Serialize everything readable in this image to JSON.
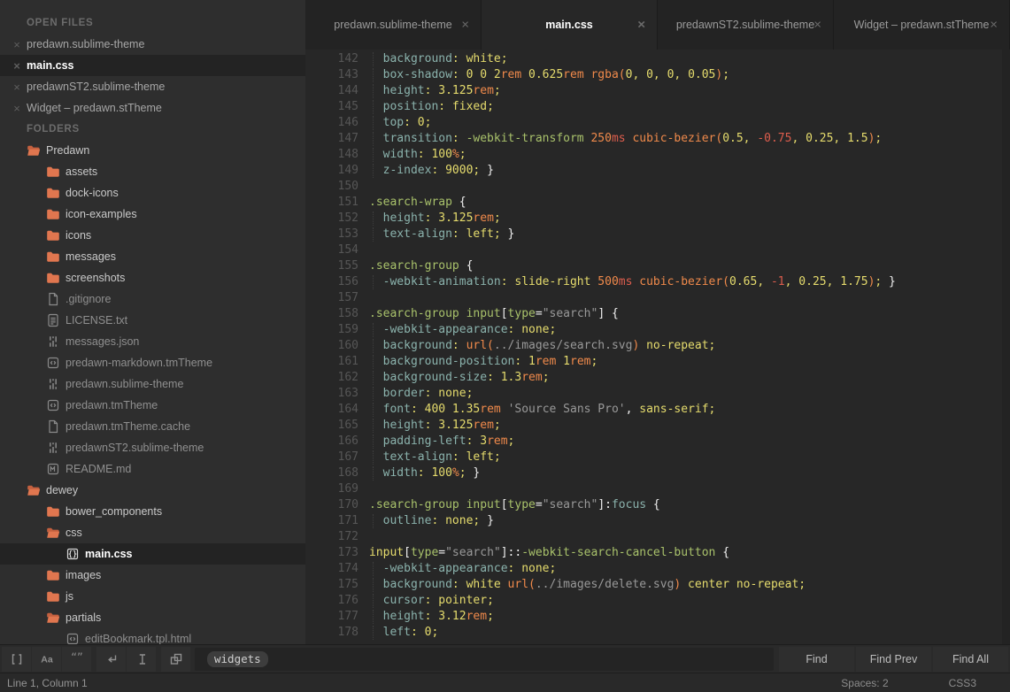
{
  "sidebar": {
    "open_files_heading": "OPEN FILES",
    "folders_heading": "FOLDERS",
    "folder_color": "#e0764f",
    "folder_color_dark": "#c4603f",
    "open_files": [
      {
        "label": "predawn.sublime-theme",
        "selected": false
      },
      {
        "label": "main.css",
        "selected": true
      },
      {
        "label": "predawnST2.sublime-theme",
        "selected": false
      },
      {
        "label": "Widget – predawn.stTheme",
        "selected": false
      }
    ],
    "tree": [
      {
        "label": "Predawn",
        "icon": "folder-open",
        "level": 0
      },
      {
        "label": "assets",
        "icon": "folder",
        "level": 1
      },
      {
        "label": "dock-icons",
        "icon": "folder",
        "level": 1
      },
      {
        "label": "icon-examples",
        "icon": "folder",
        "level": 1
      },
      {
        "label": "icons",
        "icon": "folder",
        "level": 1
      },
      {
        "label": "messages",
        "icon": "folder",
        "level": 1
      },
      {
        "label": "screenshots",
        "icon": "folder",
        "level": 1
      },
      {
        "label": ".gitignore",
        "icon": "file",
        "level": 1,
        "dim": true
      },
      {
        "label": "LICENSE.txt",
        "icon": "file-text",
        "level": 1,
        "dim": true
      },
      {
        "label": "messages.json",
        "icon": "file-settings",
        "level": 1,
        "dim": true
      },
      {
        "label": "predawn-markdown.tmTheme",
        "icon": "file-code",
        "level": 1,
        "dim": true
      },
      {
        "label": "predawn.sublime-theme",
        "icon": "file-settings",
        "level": 1,
        "dim": true
      },
      {
        "label": "predawn.tmTheme",
        "icon": "file-code",
        "level": 1,
        "dim": true
      },
      {
        "label": "predawn.tmTheme.cache",
        "icon": "file",
        "level": 1,
        "dim": true
      },
      {
        "label": "predawnST2.sublime-theme",
        "icon": "file-settings",
        "level": 1,
        "dim": true
      },
      {
        "label": "README.md",
        "icon": "file-markdown",
        "level": 1,
        "dim": true
      },
      {
        "label": "dewey",
        "icon": "folder-open",
        "level": 0
      },
      {
        "label": "bower_components",
        "icon": "folder",
        "level": 1
      },
      {
        "label": "css",
        "icon": "folder-open",
        "level": 1
      },
      {
        "label": "main.css",
        "icon": "file-css",
        "level": 2,
        "selected": true
      },
      {
        "label": "images",
        "icon": "folder",
        "level": 1
      },
      {
        "label": "js",
        "icon": "folder",
        "level": 1
      },
      {
        "label": "partials",
        "icon": "folder-open",
        "level": 1
      },
      {
        "label": "editBookmark.tpl.html",
        "icon": "file-code",
        "level": 2,
        "dim": true
      }
    ]
  },
  "tabs": [
    {
      "label": "predawn.sublime-theme",
      "active": false
    },
    {
      "label": "main.css",
      "active": true
    },
    {
      "label": "predawnST2.sublime-theme",
      "active": false
    },
    {
      "label": "Widget – predawn.stTheme",
      "active": false
    }
  ],
  "editor": {
    "colors": {
      "t": "#8bb3ad",
      "y": "#e6dc6d",
      "g": "#a9c26b",
      "o": "#f08a4b",
      "r": "#dd5d4d",
      "s": "#999999",
      "w": "#f1f1f1"
    },
    "lines": [
      {
        "n": "142",
        "tokens": [
          [
            "t",
            "  background"
          ],
          [
            "y",
            ": white;"
          ]
        ]
      },
      {
        "n": "143",
        "tokens": [
          [
            "t",
            "  box-shadow"
          ],
          [
            "y",
            ": 0 0 2"
          ],
          [
            "o",
            "rem"
          ],
          [
            "y",
            " 0.625"
          ],
          [
            "o",
            "rem"
          ],
          [
            "w",
            " "
          ],
          [
            "o",
            "rgba("
          ],
          [
            "y",
            "0, 0, 0, 0.05"
          ],
          [
            "o",
            ")"
          ],
          [
            "y",
            ";"
          ]
        ]
      },
      {
        "n": "144",
        "tokens": [
          [
            "t",
            "  height"
          ],
          [
            "y",
            ": 3.125"
          ],
          [
            "o",
            "rem"
          ],
          [
            "y",
            ";"
          ]
        ]
      },
      {
        "n": "145",
        "tokens": [
          [
            "t",
            "  position"
          ],
          [
            "y",
            ": fixed;"
          ]
        ]
      },
      {
        "n": "146",
        "tokens": [
          [
            "t",
            "  top"
          ],
          [
            "y",
            ": 0;"
          ]
        ]
      },
      {
        "n": "147",
        "tokens": [
          [
            "t",
            "  transition"
          ],
          [
            "y",
            ": "
          ],
          [
            "g",
            "-webkit-transform"
          ],
          [
            "w",
            " "
          ],
          [
            "o",
            "250"
          ],
          [
            "r",
            "ms"
          ],
          [
            "w",
            " "
          ],
          [
            "o",
            "cubic-bezier("
          ],
          [
            "y",
            "0.5, "
          ],
          [
            "r",
            "-0.75"
          ],
          [
            "y",
            ", 0.25, 1.5"
          ],
          [
            "o",
            ")"
          ],
          [
            "y",
            ";"
          ]
        ]
      },
      {
        "n": "148",
        "tokens": [
          [
            "t",
            "  width"
          ],
          [
            "y",
            ": 100"
          ],
          [
            "o",
            "%"
          ],
          [
            "y",
            ";"
          ]
        ]
      },
      {
        "n": "149",
        "tokens": [
          [
            "t",
            "  z-index"
          ],
          [
            "y",
            ": 9000;"
          ],
          [
            "w",
            " }"
          ]
        ]
      },
      {
        "n": "150",
        "tokens": []
      },
      {
        "n": "151",
        "tokens": [
          [
            "g",
            ".search-wrap"
          ],
          [
            "w",
            " {"
          ]
        ]
      },
      {
        "n": "152",
        "tokens": [
          [
            "t",
            "  height"
          ],
          [
            "y",
            ": 3.125"
          ],
          [
            "o",
            "rem"
          ],
          [
            "y",
            ";"
          ]
        ]
      },
      {
        "n": "153",
        "tokens": [
          [
            "t",
            "  text-align"
          ],
          [
            "y",
            ": left;"
          ],
          [
            "w",
            " }"
          ]
        ]
      },
      {
        "n": "154",
        "tokens": []
      },
      {
        "n": "155",
        "tokens": [
          [
            "g",
            ".search-group"
          ],
          [
            "w",
            " {"
          ]
        ]
      },
      {
        "n": "156",
        "tokens": [
          [
            "t",
            "  -webkit-animation"
          ],
          [
            "y",
            ": slide-right "
          ],
          [
            "o",
            "500"
          ],
          [
            "r",
            "ms"
          ],
          [
            "w",
            " "
          ],
          [
            "o",
            "cubic-bezier("
          ],
          [
            "y",
            "0.65, "
          ],
          [
            "r",
            "-1"
          ],
          [
            "y",
            ", 0.25, 1.75"
          ],
          [
            "o",
            ")"
          ],
          [
            "y",
            "; "
          ],
          [
            "w",
            "}"
          ]
        ]
      },
      {
        "n": "157",
        "tokens": []
      },
      {
        "n": "158",
        "tokens": [
          [
            "g",
            ".search-group input"
          ],
          [
            "w",
            "["
          ],
          [
            "g",
            "type"
          ],
          [
            "w",
            "="
          ],
          [
            "s",
            "\"search\""
          ],
          [
            "w",
            "] {"
          ]
        ]
      },
      {
        "n": "159",
        "tokens": [
          [
            "t",
            "  -webkit-appearance"
          ],
          [
            "y",
            ": none;"
          ]
        ]
      },
      {
        "n": "160",
        "tokens": [
          [
            "t",
            "  background"
          ],
          [
            "y",
            ": "
          ],
          [
            "o",
            "url("
          ],
          [
            "s",
            "../images/search.svg"
          ],
          [
            "o",
            ")"
          ],
          [
            "y",
            " no-repeat;"
          ]
        ]
      },
      {
        "n": "161",
        "tokens": [
          [
            "t",
            "  background-position"
          ],
          [
            "y",
            ": 1"
          ],
          [
            "o",
            "rem"
          ],
          [
            "y",
            " 1"
          ],
          [
            "o",
            "rem"
          ],
          [
            "y",
            ";"
          ]
        ]
      },
      {
        "n": "162",
        "tokens": [
          [
            "t",
            "  background-size"
          ],
          [
            "y",
            ": 1.3"
          ],
          [
            "o",
            "rem"
          ],
          [
            "y",
            ";"
          ]
        ]
      },
      {
        "n": "163",
        "tokens": [
          [
            "t",
            "  border"
          ],
          [
            "y",
            ": none;"
          ]
        ]
      },
      {
        "n": "164",
        "tokens": [
          [
            "t",
            "  font"
          ],
          [
            "y",
            ": 400 1.35"
          ],
          [
            "o",
            "rem"
          ],
          [
            "y",
            " "
          ],
          [
            "s",
            "'Source Sans Pro'"
          ],
          [
            "w",
            ","
          ],
          [
            "y",
            " sans-serif;"
          ]
        ]
      },
      {
        "n": "165",
        "tokens": [
          [
            "t",
            "  height"
          ],
          [
            "y",
            ": 3.125"
          ],
          [
            "o",
            "rem"
          ],
          [
            "y",
            ";"
          ]
        ]
      },
      {
        "n": "166",
        "tokens": [
          [
            "t",
            "  padding-left"
          ],
          [
            "y",
            ": 3"
          ],
          [
            "o",
            "rem"
          ],
          [
            "y",
            ";"
          ]
        ]
      },
      {
        "n": "167",
        "tokens": [
          [
            "t",
            "  text-align"
          ],
          [
            "y",
            ": left;"
          ]
        ]
      },
      {
        "n": "168",
        "tokens": [
          [
            "t",
            "  width"
          ],
          [
            "y",
            ": 100"
          ],
          [
            "o",
            "%"
          ],
          [
            "y",
            "; "
          ],
          [
            "w",
            "}"
          ]
        ]
      },
      {
        "n": "169",
        "tokens": []
      },
      {
        "n": "170",
        "tokens": [
          [
            "g",
            ".search-group input"
          ],
          [
            "w",
            "["
          ],
          [
            "g",
            "type"
          ],
          [
            "w",
            "="
          ],
          [
            "s",
            "\"search\""
          ],
          [
            "w",
            "]:"
          ],
          [
            "t",
            "focus"
          ],
          [
            "w",
            " {"
          ]
        ]
      },
      {
        "n": "171",
        "tokens": [
          [
            "t",
            "  outline"
          ],
          [
            "y",
            ": none;"
          ],
          [
            "w",
            " }"
          ]
        ]
      },
      {
        "n": "172",
        "tokens": []
      },
      {
        "n": "173",
        "tokens": [
          [
            "y",
            "input"
          ],
          [
            "w",
            "["
          ],
          [
            "g",
            "type"
          ],
          [
            "w",
            "="
          ],
          [
            "s",
            "\"search\""
          ],
          [
            "w",
            "]::"
          ],
          [
            "g",
            "-webkit-search-cancel-button"
          ],
          [
            "w",
            " {"
          ]
        ]
      },
      {
        "n": "174",
        "tokens": [
          [
            "t",
            "  -webkit-appearance"
          ],
          [
            "y",
            ": none;"
          ]
        ]
      },
      {
        "n": "175",
        "tokens": [
          [
            "t",
            "  background"
          ],
          [
            "y",
            ": white "
          ],
          [
            "o",
            "url("
          ],
          [
            "s",
            "../images/delete.svg"
          ],
          [
            "o",
            ")"
          ],
          [
            "y",
            " center no-repeat;"
          ]
        ]
      },
      {
        "n": "176",
        "tokens": [
          [
            "t",
            "  cursor"
          ],
          [
            "y",
            ": pointer;"
          ]
        ]
      },
      {
        "n": "177",
        "tokens": [
          [
            "t",
            "  height"
          ],
          [
            "y",
            ": 3.12"
          ],
          [
            "o",
            "rem"
          ],
          [
            "y",
            ";"
          ]
        ]
      },
      {
        "n": "178",
        "tokens": [
          [
            "t",
            "  left"
          ],
          [
            "y",
            ": 0;"
          ]
        ]
      }
    ]
  },
  "find_bar": {
    "query": "widgets",
    "toggle_groups": [
      [
        "regex",
        "case-sensitive",
        "whole-word"
      ],
      [
        "wrap",
        "in-selection"
      ],
      [
        "highlight-matches"
      ]
    ],
    "buttons": [
      "Find",
      "Find Prev",
      "Find All"
    ]
  },
  "status_bar": {
    "position": "Line 1, Column 1",
    "indent": "Spaces: 2",
    "syntax": "CSS3"
  }
}
